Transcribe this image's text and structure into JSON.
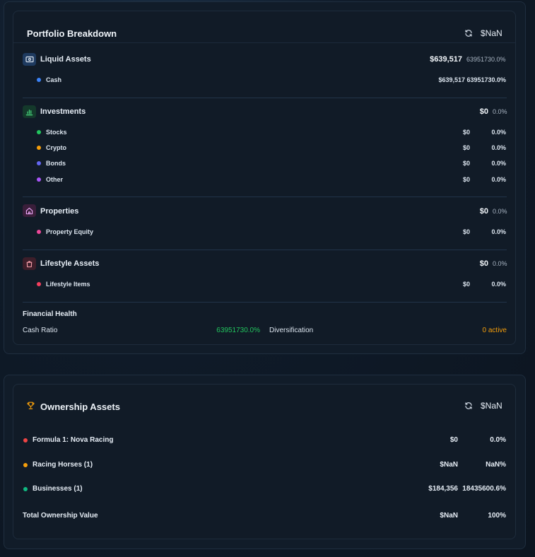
{
  "portfolio": {
    "title": "Portfolio Breakdown",
    "total": "$NaN",
    "categories": [
      {
        "label": "Liquid Assets",
        "icon": "cash-icon",
        "value": "$639,517",
        "percent": "63951730.0%",
        "items": [
          {
            "label": "Cash",
            "color": "#3b82f6",
            "value": "$639,517",
            "percent": "63951730.0%"
          }
        ]
      },
      {
        "label": "Investments",
        "icon": "bar-chart-icon",
        "value": "$0",
        "percent": "0.0%",
        "items": [
          {
            "label": "Stocks",
            "color": "#22c55e",
            "value": "$0",
            "percent": "0.0%"
          },
          {
            "label": "Crypto",
            "color": "#f59e0b",
            "value": "$0",
            "percent": "0.0%"
          },
          {
            "label": "Bonds",
            "color": "#6366f1",
            "value": "$0",
            "percent": "0.0%"
          },
          {
            "label": "Other",
            "color": "#a855f7",
            "value": "$0",
            "percent": "0.0%"
          }
        ]
      },
      {
        "label": "Properties",
        "icon": "home-icon",
        "value": "$0",
        "percent": "0.0%",
        "items": [
          {
            "label": "Property Equity",
            "color": "#ec4899",
            "value": "$0",
            "percent": "0.0%"
          }
        ]
      },
      {
        "label": "Lifestyle Assets",
        "icon": "shopping-bag-icon",
        "value": "$0",
        "percent": "0.0%",
        "items": [
          {
            "label": "Lifestyle Items",
            "color": "#f43f5e",
            "value": "$0",
            "percent": "0.0%"
          }
        ]
      }
    ],
    "financial_health": {
      "title": "Financial Health",
      "cash_ratio_label": "Cash Ratio",
      "cash_ratio_value": "63951730.0%",
      "diversification_label": "Diversification",
      "diversification_value": "0 active"
    }
  },
  "ownership": {
    "title": "Ownership Assets",
    "total": "$NaN",
    "items": [
      {
        "label": "Formula 1: Nova Racing",
        "color": "#ef4444",
        "value": "$0",
        "percent": "0.0%"
      },
      {
        "label": "Racing Horses (1)",
        "color": "#f59e0b",
        "value": "$NaN",
        "percent": "NaN%"
      },
      {
        "label": "Businesses (1)",
        "color": "#10b981",
        "value": "$184,356",
        "percent": "18435600.6%"
      }
    ],
    "total_row": {
      "label": "Total Ownership Value",
      "value": "$NaN",
      "percent": "100%"
    }
  },
  "colors": {
    "liquid_icon_bg": "#1e3a5f",
    "invest_icon_bg": "#14392b",
    "property_icon_bg": "#3a1e3a",
    "lifestyle_icon_bg": "#3d1e2a",
    "trophy": "#f59e0b"
  }
}
